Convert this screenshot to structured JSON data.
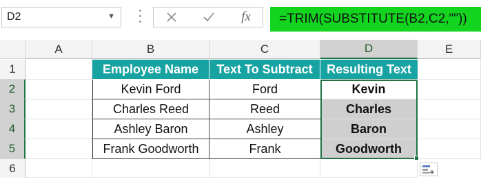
{
  "name_box": {
    "value": "D2",
    "icon": "chevron-down-icon"
  },
  "formula_bar": {
    "cancel_icon": "close-icon",
    "enter_icon": "check-icon",
    "fx_label": "fx",
    "formula": "=TRIM(SUBSTITUTE(B2,C2,\"\"))"
  },
  "columns": [
    "A",
    "B",
    "C",
    "D",
    "E"
  ],
  "rows": [
    "1",
    "2",
    "3",
    "4",
    "5",
    "6"
  ],
  "selected_cell": {
    "column": "D",
    "row": "2"
  },
  "table": {
    "headers": [
      "Employee Name",
      "Text To Subtract",
      "Resulting Text"
    ],
    "rows": [
      [
        "Kevin Ford",
        "Ford",
        "Kevin"
      ],
      [
        "Charles Reed",
        "Reed",
        "Charles"
      ],
      [
        "Ashley Baron",
        "Ashley",
        "Baron"
      ],
      [
        "Frank Goodworth",
        "Frank",
        "Goodworth"
      ]
    ]
  },
  "colors": {
    "header_fill": "#18a3a3",
    "formula_highlight": "#13d41f",
    "selection": "#217346",
    "result_fill": "#cfcfcf"
  },
  "quick_analysis_icon": "quick-analysis-icon"
}
